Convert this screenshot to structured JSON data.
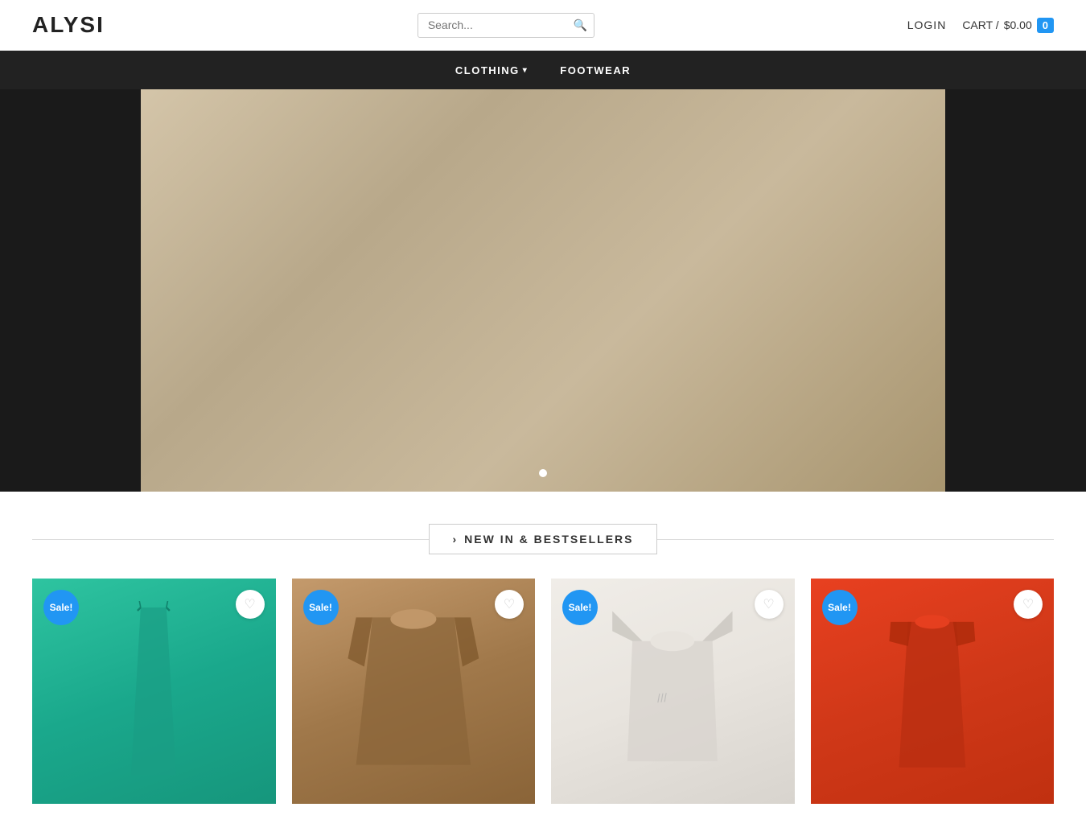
{
  "brand": {
    "name": "ALYSI"
  },
  "header": {
    "search_placeholder": "Search...",
    "login_label": "LOGIN",
    "cart_label": "CART /",
    "cart_price": "$0.00",
    "cart_count": "0"
  },
  "nav": {
    "items": [
      {
        "label": "CLOTHING",
        "has_dropdown": true
      },
      {
        "label": "FOOTWEAR",
        "has_dropdown": false
      }
    ]
  },
  "hero": {
    "slide_count": 1,
    "active_slide": 0
  },
  "section": {
    "new_arrivals_label": "NEW IN & BESTSELLERS",
    "chevron_icon": "›"
  },
  "products": [
    {
      "id": 1,
      "sale": true,
      "sale_label": "Sale!",
      "color": "teal",
      "type": "dress",
      "bg_color": "#2ec4a0"
    },
    {
      "id": 2,
      "sale": true,
      "sale_label": "Sale!",
      "color": "brown",
      "type": "top",
      "bg_color": "#c49a6c"
    },
    {
      "id": 3,
      "sale": true,
      "sale_label": "Sale!",
      "color": "white",
      "type": "tshirt",
      "bg_color": "#e8e4de"
    },
    {
      "id": 4,
      "sale": true,
      "sale_label": "Sale!",
      "color": "orange-red",
      "type": "dress",
      "bg_color": "#e84020"
    }
  ],
  "icons": {
    "search": "🔍",
    "heart": "♡",
    "cart": "🛒",
    "chevron_down": "▾",
    "chevron_right": "›"
  }
}
